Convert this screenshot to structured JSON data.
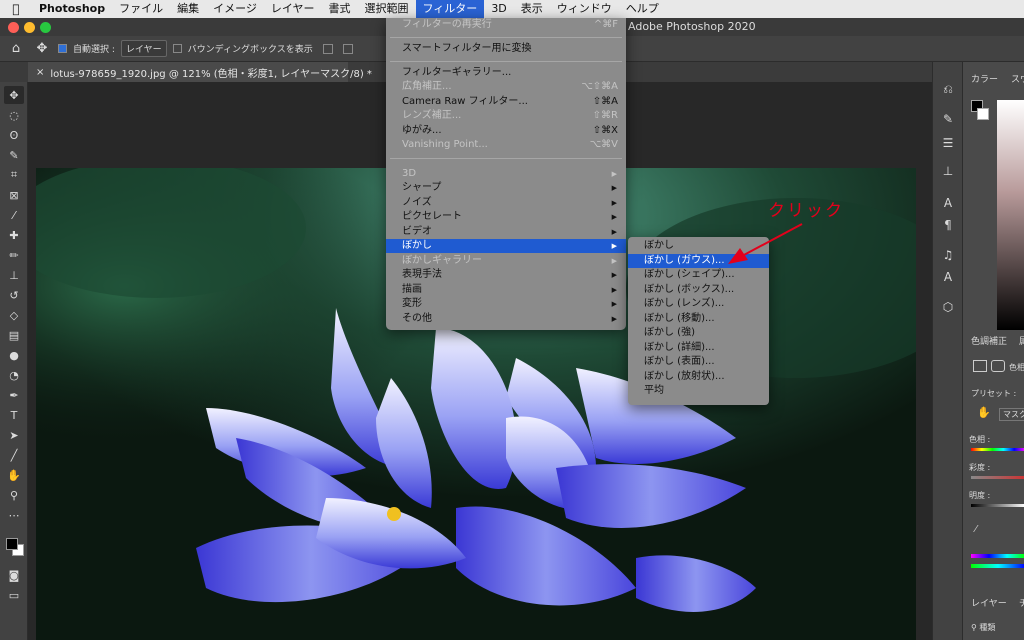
{
  "menubar": {
    "app_name": "Photoshop",
    "items": [
      "ファイル",
      "編集",
      "イメージ",
      "レイヤー",
      "書式",
      "選択範囲",
      "フィルター",
      "3D",
      "表示",
      "ウィンドウ",
      "ヘルプ"
    ],
    "active_item": "フィルター"
  },
  "window": {
    "title": "Adobe Photoshop 2020"
  },
  "options_bar": {
    "auto_select_label": "自動選択 :",
    "auto_select_target": "レイヤー",
    "bounding_box_label": "バウンディングボックスを表示"
  },
  "document_tab": {
    "close_glyph": "×",
    "title": "lotus-978659_1920.jpg @ 121% (色相・彩度1, レイヤーマスク/8) *"
  },
  "filter_menu": {
    "last_filter": {
      "label": "フィルターの再実行",
      "shortcut": "^⌘F"
    },
    "smart_filter": "スマートフィルター用に変換",
    "group2": [
      {
        "label": "フィルターギャラリー...",
        "shortcut": "",
        "disabled": false
      },
      {
        "label": "広角補正...",
        "shortcut": "⌥⇧⌘A",
        "disabled": true
      },
      {
        "label": "Camera Raw フィルター...",
        "shortcut": "⇧⌘A",
        "disabled": false
      },
      {
        "label": "レンズ補正...",
        "shortcut": "⇧⌘R",
        "disabled": true
      },
      {
        "label": "ゆがみ...",
        "shortcut": "⇧⌘X",
        "disabled": false
      },
      {
        "label": "Vanishing Point...",
        "shortcut": "⌥⌘V",
        "disabled": true
      }
    ],
    "group3": [
      {
        "label": "3D",
        "disabled": true
      },
      {
        "label": "シャープ",
        "disabled": false
      },
      {
        "label": "ノイズ",
        "disabled": false
      },
      {
        "label": "ピクセレート",
        "disabled": false
      },
      {
        "label": "ビデオ",
        "disabled": false
      },
      {
        "label": "ぼかし",
        "disabled": false,
        "highlighted": true
      },
      {
        "label": "ぼかしギャラリー",
        "disabled": true
      },
      {
        "label": "表現手法",
        "disabled": false
      },
      {
        "label": "描画",
        "disabled": false
      },
      {
        "label": "変形",
        "disabled": false
      },
      {
        "label": "その他",
        "disabled": false
      }
    ]
  },
  "blur_submenu": {
    "items": [
      {
        "label": "ぼかし"
      },
      {
        "label": "ぼかし (ガウス)...",
        "highlighted": true
      },
      {
        "label": "ぼかし (シェイプ)..."
      },
      {
        "label": "ぼかし (ボックス)..."
      },
      {
        "label": "ぼかし (レンズ)..."
      },
      {
        "label": "ぼかし (移動)..."
      },
      {
        "label": "ぼかし (強)"
      },
      {
        "label": "ぼかし (詳細)..."
      },
      {
        "label": "ぼかし (表面)..."
      },
      {
        "label": "ぼかし (放射状)..."
      },
      {
        "label": "平均"
      }
    ]
  },
  "annotation": {
    "text": "クリック",
    "color": "#e3001b"
  },
  "right_panel": {
    "color_tab": "カラー",
    "swatch_tab": "スウ",
    "adjust_tab": "色調補正",
    "adjust_tab2": "属",
    "color_label": "色相",
    "preset_label": "プリセット :",
    "mask_label": "マスク",
    "hue_label": "色相 :",
    "saturation_label": "彩度 :",
    "lightness_label": "明度 :",
    "layers_tab": "レイヤー",
    "layers_tab2": "チ",
    "kind_label": "種類"
  },
  "colors": {
    "accent": "#2a63d4",
    "highlight": "#1f5bd1",
    "menu_bg": "#8b8b8b",
    "panel_bg": "#4a4a4a",
    "annotation": "#e3001b"
  }
}
